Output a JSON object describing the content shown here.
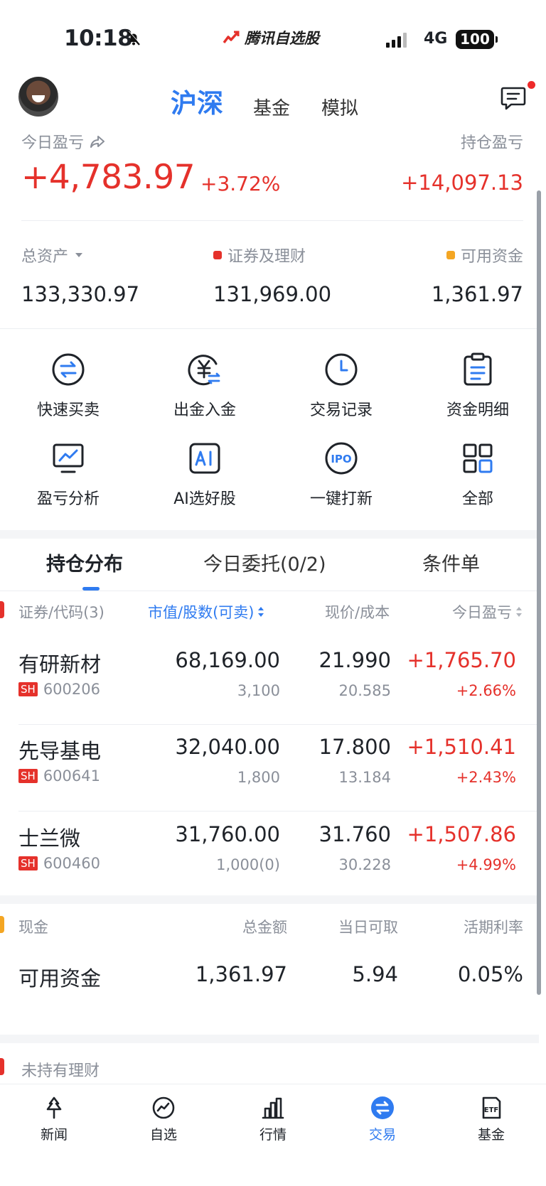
{
  "status_bar": {
    "time": "10:18",
    "brand": "腾讯自选股",
    "network": "4G",
    "battery": "100"
  },
  "top_nav": {
    "tabs": [
      {
        "label": "沪深",
        "active": true
      },
      {
        "label": "基金",
        "active": false
      },
      {
        "label": "模拟",
        "active": false
      }
    ]
  },
  "summary": {
    "today_pnl_label": "今日盈亏",
    "today_pnl_value": "+4,783.97",
    "today_pnl_pct": "+3.72%",
    "holding_pnl_label": "持仓盈亏",
    "holding_pnl_value": "+14,097.13",
    "total_assets_label": "总资产",
    "total_assets_value": "133,330.97",
    "securities_label": "证券及理财",
    "securities_value": "131,969.00",
    "available_label": "可用资金",
    "available_value": "1,361.97"
  },
  "quick_actions": [
    {
      "label": "快速买卖",
      "icon": "swap-circle-icon"
    },
    {
      "label": "出金入金",
      "icon": "yuan-transfer-icon"
    },
    {
      "label": "交易记录",
      "icon": "clock-icon"
    },
    {
      "label": "资金明细",
      "icon": "clipboard-icon"
    },
    {
      "label": "盈亏分析",
      "icon": "chart-monitor-icon"
    },
    {
      "label": "AI选好股",
      "icon": "ai-icon"
    },
    {
      "label": "一键打新",
      "icon": "ipo-icon"
    },
    {
      "label": "全部",
      "icon": "grid-icon"
    }
  ],
  "position_tabs": [
    {
      "label": "持仓分布",
      "active": true
    },
    {
      "label": "今日委托(0/2)",
      "active": false
    },
    {
      "label": "条件单",
      "active": false
    }
  ],
  "table_headers": {
    "security": "证券/代码(3)",
    "market_value": "市值/股数(可卖)",
    "price": "现价/成本",
    "today_pnl": "今日盈亏"
  },
  "holdings": [
    {
      "name": "有研新材",
      "market": "SH",
      "code": "600206",
      "market_value": "68,169.00",
      "shares": "3,100",
      "price": "21.990",
      "cost": "20.585",
      "pnl": "+1,765.70",
      "pnl_pct": "+2.66%"
    },
    {
      "name": "先导基电",
      "market": "SH",
      "code": "600641",
      "market_value": "32,040.00",
      "shares": "1,800",
      "price": "17.800",
      "cost": "13.184",
      "pnl": "+1,510.41",
      "pnl_pct": "+2.43%"
    },
    {
      "name": "士兰微",
      "market": "SH",
      "code": "600460",
      "market_value": "31,760.00",
      "shares": "1,000(0)",
      "price": "31.760",
      "cost": "30.228",
      "pnl": "+1,507.86",
      "pnl_pct": "+4.99%"
    }
  ],
  "cash": {
    "header_label": "现金",
    "header_total": "总金额",
    "header_withdrawable": "当日可取",
    "header_rate": "活期利率",
    "row_label": "可用资金",
    "total": "1,361.97",
    "withdrawable": "5.94",
    "rate": "0.05%"
  },
  "unheld_label": "未持有理财",
  "bottom_nav": [
    {
      "label": "新闻",
      "icon": "news-icon",
      "active": false
    },
    {
      "label": "自选",
      "icon": "watchlist-icon",
      "active": false
    },
    {
      "label": "行情",
      "icon": "market-icon",
      "active": false
    },
    {
      "label": "交易",
      "icon": "trade-icon",
      "active": true
    },
    {
      "label": "基金",
      "icon": "etf-icon",
      "active": false
    }
  ],
  "colors": {
    "accent_blue": "#2f7bf0",
    "up_red": "#e5312b",
    "securities_dot": "#e5312b",
    "available_dot": "#f4a623"
  }
}
